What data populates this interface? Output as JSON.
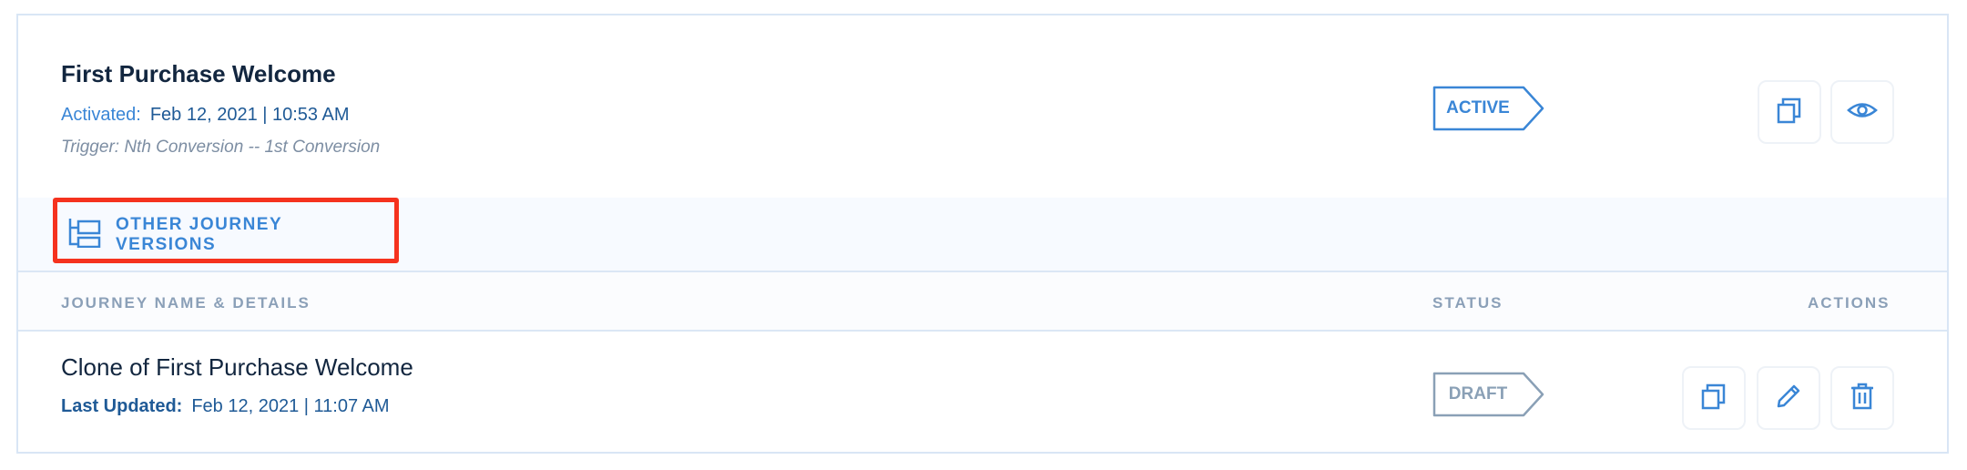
{
  "current_journey": {
    "title": "First Purchase Welcome",
    "activated_label": "Activated:",
    "activated_value": "Feb 12, 2021 | 10:53 AM",
    "trigger": "Trigger: Nth Conversion -- 1st Conversion",
    "status": "ACTIVE",
    "actions": [
      "copy-icon",
      "eye-icon"
    ]
  },
  "versions_link": {
    "label": "OTHER JOURNEY VERSIONS",
    "icon": "tree-icon"
  },
  "table": {
    "columns": [
      "JOURNEY NAME & DETAILS",
      "STATUS",
      "ACTIONS"
    ],
    "rows": [
      {
        "title": "Clone of First Purchase Welcome",
        "updated_label": "Last Updated:",
        "updated_value": "Feb 12, 2021 | 11:07 AM",
        "status": "DRAFT",
        "actions": [
          "copy-icon",
          "pencil-icon",
          "trash-icon"
        ]
      }
    ]
  },
  "colors": {
    "accent": "#3a86d6",
    "highlight": "#f5321e",
    "title": "#12263f",
    "muted": "#8aa0b6"
  }
}
